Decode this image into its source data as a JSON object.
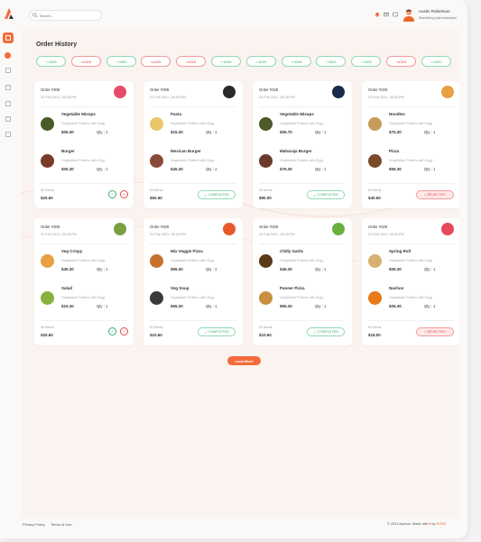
{
  "header": {
    "search_placeholder": "Search...",
    "user_name": "Austin Robertson",
    "user_role": "Marketing Administrator"
  },
  "page": {
    "title": "Order History"
  },
  "filters": [
    {
      "label": "#308",
      "status": "ok"
    },
    {
      "label": "#325",
      "status": "no"
    },
    {
      "label": "#350",
      "status": "ok"
    },
    {
      "label": "#325",
      "status": "no"
    },
    {
      "label": "#328",
      "status": "no"
    },
    {
      "label": "#285",
      "status": "ok"
    },
    {
      "label": "#239",
      "status": "ok"
    },
    {
      "label": "#296",
      "status": "ok"
    },
    {
      "label": "#301",
      "status": "ok"
    },
    {
      "label": "#325",
      "status": "ok"
    },
    {
      "label": "#329",
      "status": "no"
    },
    {
      "label": "#320",
      "status": "ok"
    }
  ],
  "orders": [
    {
      "id": "Order #308",
      "date": "22 Feb 2021, 08:28 PM",
      "avatar_color": "#e84a6a",
      "items": [
        {
          "name": "Vegetable Mixups",
          "desc": "Vegetable Fritters with Egg",
          "price": "$05.30",
          "qty": "Qty : 1",
          "food_color": "#4a5a2a"
        },
        {
          "name": "Burger",
          "desc": "Vegetable Fritters with Egg",
          "price": "$05.30",
          "qty": "Qty : 1",
          "food_color": "#7a3a2a"
        }
      ],
      "count": "02 Items",
      "total": "$20.60",
      "footer": "actions"
    },
    {
      "id": "Order #309",
      "date": "22 Feb 2021, 08:25 PM",
      "avatar_color": "#2a2a2a",
      "items": [
        {
          "name": "Pasta",
          "desc": "Vegetable Fritters with Egg",
          "price": "$15.30",
          "qty": "Qty : 1",
          "food_color": "#e8c86a"
        },
        {
          "name": "Mexican Burger",
          "desc": "Vegetable Fritters with Egg",
          "price": "$45.30",
          "qty": "Qty : 1",
          "food_color": "#8a4a3a"
        }
      ],
      "count": "02 Items",
      "total": "$50.60",
      "status_label": "COMPLETED",
      "footer": "completed"
    },
    {
      "id": "Order #328",
      "date": "22 Feb 2021, 08:28 PM",
      "avatar_color": "#1a2a4a",
      "items": [
        {
          "name": "Vegetable Mixups",
          "desc": "Vegetable Fritters with Egg",
          "price": "$05.70",
          "qty": "Qty : 1",
          "food_color": "#4a5a2a"
        },
        {
          "name": "Maharaja Burger",
          "desc": "Vegetable Fritters with Egg",
          "price": "$75.30",
          "qty": "Qty : 1",
          "food_color": "#6a3a2a"
        }
      ],
      "count": "02 Items",
      "total": "$90.00",
      "status_label": "COMPLETED",
      "footer": "completed"
    },
    {
      "id": "Order #329",
      "date": "22 Feb 2021, 08:28 PM",
      "avatar_color": "#e8a040",
      "items": [
        {
          "name": "Noodles",
          "desc": "Vegetable Fritters with Egg",
          "price": "$75.30",
          "qty": "Qty : 1",
          "food_color": "#c89a5a"
        },
        {
          "name": "Pizza",
          "desc": "Vegetable Fritters with Egg",
          "price": "$55.30",
          "qty": "Qty : 1",
          "food_color": "#7a4a2a"
        }
      ],
      "count": "02 Items",
      "total": "$40.60",
      "status_label": "REJECTED",
      "footer": "rejected"
    },
    {
      "id": "Order #308",
      "date": "22 Feb 2021, 08:28 PM",
      "avatar_color": "#7aa040",
      "items": [
        {
          "name": "Veg Crispy",
          "desc": "Vegetable Fritters with Egg",
          "price": "$45.30",
          "qty": "Qty : 1",
          "food_color": "#e8a040"
        },
        {
          "name": "Salad",
          "desc": "Vegetable Fritters with Egg",
          "price": "$15.30",
          "qty": "Qty : 1",
          "food_color": "#8ab040"
        }
      ],
      "count": "02 Items",
      "total": "$20.60",
      "footer": "actions"
    },
    {
      "id": "Order #309",
      "date": "22 Feb 2021, 08:28 PM",
      "avatar_color": "#e85a2a",
      "items": [
        {
          "name": "Mix Veggie Pizza",
          "desc": "Vegetable Fritters with Egg",
          "price": "$55.30",
          "qty": "Qty : 1",
          "food_color": "#c8702a"
        },
        {
          "name": "Veg Soup",
          "desc": "Vegetable Fritters with Egg",
          "price": "$55.30",
          "qty": "Qty : 1",
          "food_color": "#3a3a3a"
        }
      ],
      "count": "02 Items",
      "total": "$10.60",
      "status_label": "COMPLETED",
      "footer": "completed"
    },
    {
      "id": "Order #309",
      "date": "22 Feb 2021, 08:28 PM",
      "avatar_color": "#6ab040",
      "items": [
        {
          "name": "Chilly Garlic",
          "desc": "Vegetable Fritters with Egg",
          "price": "$45.30",
          "qty": "Qty : 1",
          "food_color": "#5a3a1a"
        },
        {
          "name": "Paneer Pizza",
          "desc": "Vegetable Fritters with Egg",
          "price": "$55.30",
          "qty": "Qty : 1",
          "food_color": "#c89040"
        }
      ],
      "count": "02 Items",
      "total": "$10.60",
      "status_label": "COMPLETED",
      "footer": "completed"
    },
    {
      "id": "Order #329",
      "date": "22 Feb 2021, 08:28 PM",
      "avatar_color": "#e84a5a",
      "items": [
        {
          "name": "Spring Roll",
          "desc": "Vegetable Fritters with Egg",
          "price": "$05.30",
          "qty": "Qty : 1",
          "food_color": "#d8b070"
        },
        {
          "name": "Nachos",
          "desc": "Vegetable Fritters with Egg",
          "price": "$05.30",
          "qty": "Qty : 1",
          "food_color": "#e87a1a"
        }
      ],
      "count": "02 Items",
      "total": "$18.00",
      "status_label": "REJECTED",
      "footer": "rejected"
    }
  ],
  "load_more": "Load More",
  "footer": {
    "privacy": "Privacy Policy",
    "terms": "Terms of Use",
    "copyright": "© 2021 Apricus. Made with",
    "by": "by",
    "brand": "SOBS"
  },
  "colors": {
    "accent": "#f26b3a",
    "success": "#3aae73",
    "danger": "#e24b4b"
  }
}
